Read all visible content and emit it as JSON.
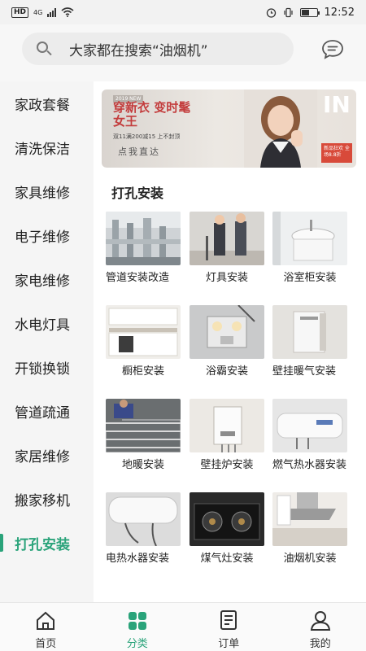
{
  "status_bar": {
    "network": "HD",
    "signal": "4G",
    "time": "12:52",
    "battery_level": 0.55
  },
  "search": {
    "placeholder": "大家都在搜索“油烟机”"
  },
  "sidebar": {
    "items": [
      {
        "label": "家政套餐",
        "active": false
      },
      {
        "label": "清洗保洁",
        "active": false
      },
      {
        "label": "家具维修",
        "active": false
      },
      {
        "label": "电子维修",
        "active": false
      },
      {
        "label": "家电维修",
        "active": false
      },
      {
        "label": "水电灯具",
        "active": false
      },
      {
        "label": "开锁换锁",
        "active": false
      },
      {
        "label": "管道疏通",
        "active": false
      },
      {
        "label": "家居维修",
        "active": false
      },
      {
        "label": "搬家移机",
        "active": false
      },
      {
        "label": "打孔安装",
        "active": true
      }
    ],
    "accent": "#2aa37a"
  },
  "banner": {
    "tag": "2019 NEW",
    "title": "穿新衣 变时髦女王",
    "subtitle": "双11满200减15 上不封顶",
    "cta": "点我直达",
    "corner_text": "IN",
    "badge": "新品狂欢 全场8.8折"
  },
  "section": {
    "title": "打孔安装"
  },
  "services": [
    {
      "label": "管道安装改造",
      "icon": "pipe-photo"
    },
    {
      "label": "灯具安装",
      "icon": "light-photo"
    },
    {
      "label": "浴室柜安装",
      "icon": "bathroom-cabinet-photo"
    },
    {
      "label": "橱柜安装",
      "icon": "kitchen-cabinet-photo"
    },
    {
      "label": "浴霸安装",
      "icon": "bath-heater-photo"
    },
    {
      "label": "壁挂暖气安装",
      "icon": "radiator-photo"
    },
    {
      "label": "地暖安装",
      "icon": "floor-heating-photo"
    },
    {
      "label": "壁挂炉安装",
      "icon": "wall-boiler-photo"
    },
    {
      "label": "燃气热水器安装",
      "icon": "gas-heater-photo"
    },
    {
      "label": "电热水器安装",
      "icon": "electric-heater-photo"
    },
    {
      "label": "煤气灶安装",
      "icon": "gas-stove-photo"
    },
    {
      "label": "油烟机安装",
      "icon": "range-hood-photo"
    }
  ],
  "tabs": [
    {
      "label": "首页",
      "icon": "home-icon",
      "active": false
    },
    {
      "label": "分类",
      "icon": "category-icon",
      "active": true
    },
    {
      "label": "订单",
      "icon": "order-icon",
      "active": false
    },
    {
      "label": "我的",
      "icon": "profile-icon",
      "active": false
    }
  ]
}
